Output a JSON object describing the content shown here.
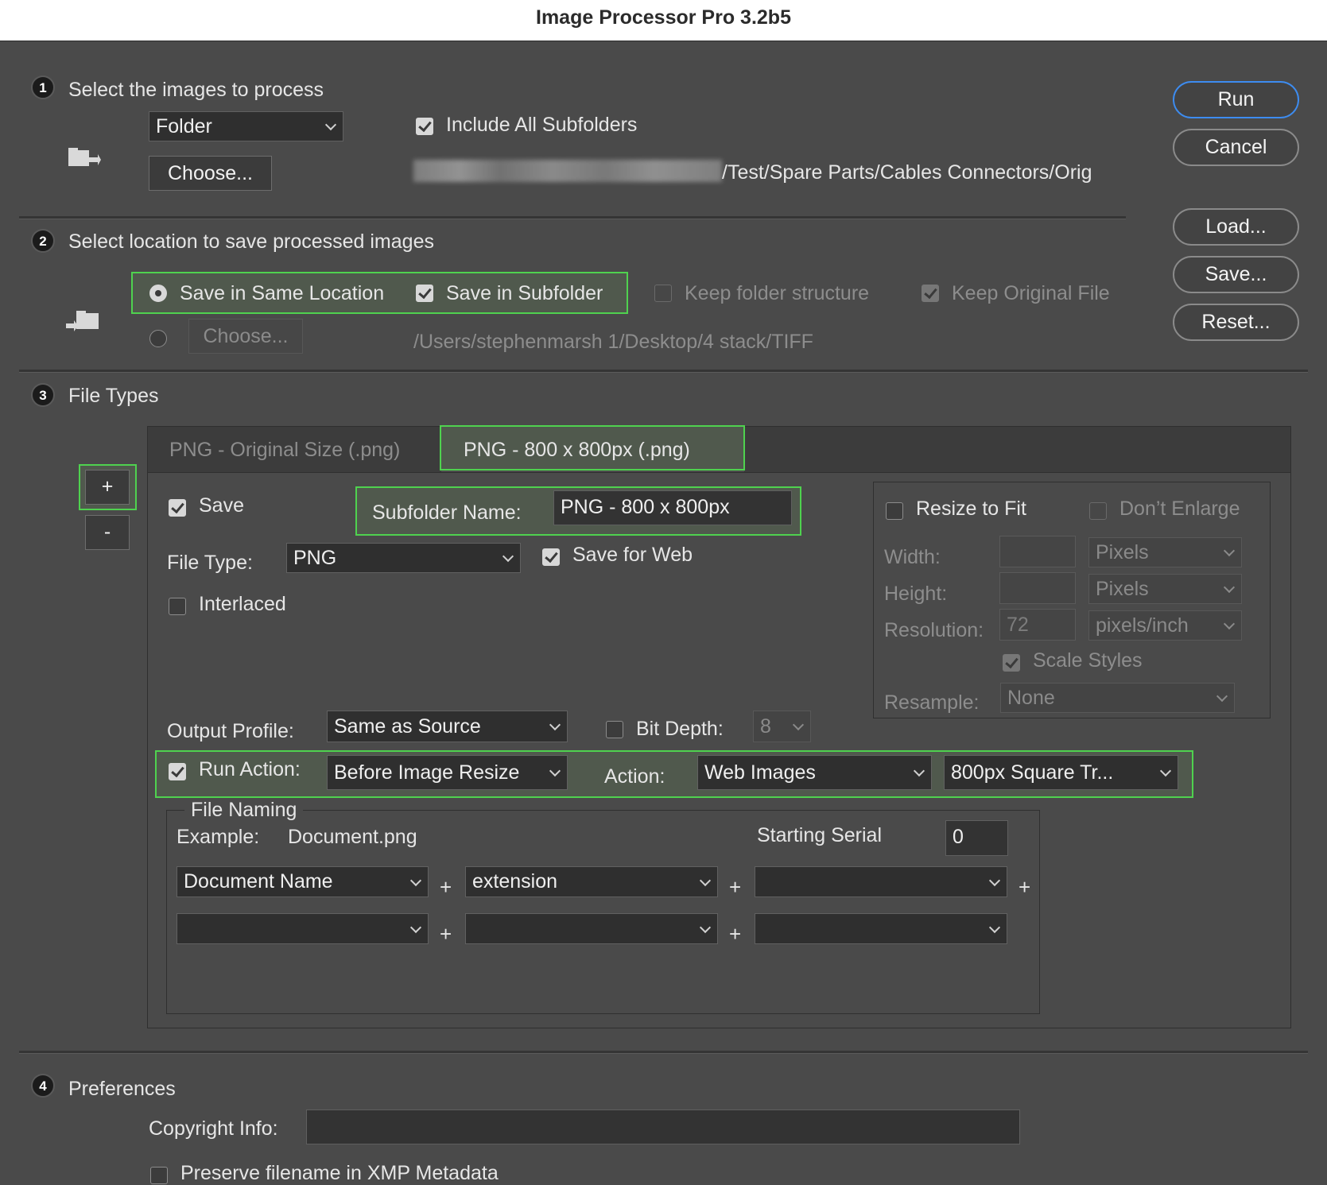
{
  "window": {
    "title": "Image Processor Pro 3.2b5"
  },
  "buttons": {
    "run": "Run",
    "cancel": "Cancel",
    "load": "Load...",
    "save": "Save...",
    "reset": "Reset..."
  },
  "section1": {
    "number": "1",
    "heading": "Select the images to process",
    "source_select": "Folder",
    "choose_button": "Choose...",
    "include_subfolders_label": "Include All Subfolders",
    "include_subfolders_checked": true,
    "path_visible": "/Test/Spare Parts/Cables  Connectors/Orig"
  },
  "section2": {
    "number": "2",
    "heading": "Select location to save processed images",
    "save_same_location_label": "Save in Same Location",
    "save_in_subfolder_label": "Save in Subfolder",
    "keep_folder_structure_label": "Keep folder structure",
    "keep_original_file_label": "Keep Original File",
    "choose_button": "Choose...",
    "dest_path": "/Users/stephenmarsh 1/Desktop/4 stack/TIFF"
  },
  "section3": {
    "number": "3",
    "heading": "File Types",
    "add_button": "+",
    "remove_button": "-",
    "tabs": [
      {
        "label": "PNG - Original Size (.png)",
        "active": false
      },
      {
        "label": "PNG - 800 x 800px (.png)",
        "active": true
      }
    ],
    "save_label": "Save",
    "subfolder_name_label": "Subfolder Name:",
    "subfolder_name_value": "PNG - 800 x 800px",
    "file_type_label": "File Type:",
    "file_type_value": "PNG",
    "save_for_web_label": "Save for Web",
    "interlaced_label": "Interlaced",
    "resize": {
      "resize_to_fit_label": "Resize to Fit",
      "dont_enlarge_label": "Don’t Enlarge",
      "width_label": "Width:",
      "height_label": "Height:",
      "resolution_label": "Resolution:",
      "resolution_value": "72",
      "width_unit": "Pixels",
      "height_unit": "Pixels",
      "resolution_unit": "pixels/inch",
      "scale_styles_label": "Scale Styles",
      "resample_label": "Resample:",
      "resample_value": "None"
    },
    "output_profile_label": "Output Profile:",
    "output_profile_value": "Same as Source",
    "bit_depth_label": "Bit Depth:",
    "bit_depth_value": "8",
    "run_action_label": "Run Action:",
    "run_action_timing": "Before Image Resize",
    "action_label": "Action:",
    "action_set": "Web Images",
    "action_name": "800px Square Tr...",
    "naming": {
      "title": "File Naming",
      "example_label": "Example:",
      "example_value": "Document.png",
      "starting_serial_label": "Starting Serial",
      "starting_serial_value": "0",
      "row1": [
        "Document Name",
        "extension",
        ""
      ],
      "row2": [
        "",
        "",
        ""
      ],
      "plus": "+"
    }
  },
  "section4": {
    "number": "4",
    "heading": "Preferences",
    "copyright_label": "Copyright Info:",
    "copyright_value": "",
    "preserve_filename_label": "Preserve filename in XMP Metadata"
  }
}
